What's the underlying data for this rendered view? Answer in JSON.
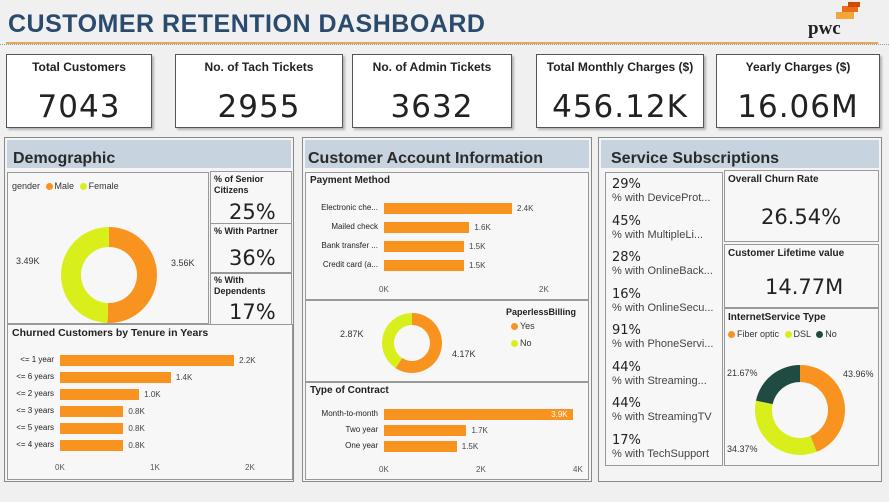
{
  "header": {
    "title": "CUSTOMER RETENTION DASHBOARD",
    "logo_text": "pwc"
  },
  "kpis": [
    {
      "label": "Total Customers",
      "value": "7043"
    },
    {
      "label": "No. of Tach Tickets",
      "value": "2955"
    },
    {
      "label": "No. of Admin Tickets",
      "value": "3632"
    },
    {
      "label": "Total Monthly Charges ($)",
      "value": "456.12K"
    },
    {
      "label": "Yearly Charges ($)",
      "value": "16.06M"
    }
  ],
  "demographic": {
    "title": "Demographic",
    "gender_legend": {
      "title": "gender",
      "items": [
        "Male",
        "Female"
      ]
    },
    "gender_left_label": "3.49K",
    "gender_right_label": "3.56K",
    "senior_label": "% of Senior Citizens",
    "senior_value": "25%",
    "partner_label": "% With Partner",
    "partner_value": "36%",
    "dependents_label": "% With Dependents",
    "dependents_value": "17%",
    "tenure_title": "Churned Customers by Tenure in Years",
    "tenure_ticks": [
      "0K",
      "1K",
      "2K"
    ]
  },
  "account": {
    "title": "Customer Account Information",
    "payment_title": "Payment Method",
    "payment_ticks": [
      "0K",
      "2K"
    ],
    "paperless_title": "PaperlessBilling",
    "paperless_items": [
      "Yes",
      "No"
    ],
    "paperless_left_label": "2.87K",
    "paperless_right_label": "4.17K",
    "contract_title": "Type of Contract",
    "contract_ticks": [
      "0K",
      "2K",
      "4K"
    ]
  },
  "services": {
    "title": "Service Subscriptions",
    "items": [
      {
        "pct": "29%",
        "label": "% with DeviceProt..."
      },
      {
        "pct": "45%",
        "label": "% with MultipleLi..."
      },
      {
        "pct": "28%",
        "label": "% with OnlineBack..."
      },
      {
        "pct": "16%",
        "label": "% with OnlineSecu..."
      },
      {
        "pct": "91%",
        "label": "% with PhoneServi..."
      },
      {
        "pct": "44%",
        "label": "% with Streaming..."
      },
      {
        "pct": "44%",
        "label": "% with StreamingTV"
      },
      {
        "pct": "17%",
        "label": "% with TechSupport"
      }
    ],
    "churn_label": "Overall Churn Rate",
    "churn_value": "26.54%",
    "ltv_label": "Customer Lifetime value",
    "ltv_value": "14.77M",
    "internet_title": "InternetService Type",
    "internet_items": [
      "Fiber optic",
      "DSL",
      "No"
    ],
    "internet_labels": {
      "fiber": "43.96%",
      "dsl": "34.37%",
      "no": "21.67%"
    }
  },
  "colors": {
    "orange": "#f7931e",
    "lime": "#d8ef1b",
    "darkgreen": "#1f4b43",
    "title_blue": "#2a4a6e",
    "header_band": "#c7d3de"
  },
  "chart_data": [
    {
      "type": "pie",
      "title": "gender",
      "categories": [
        "Male",
        "Female"
      ],
      "values": [
        3.56,
        3.49
      ],
      "unit": "K"
    },
    {
      "type": "bar",
      "title": "Churned Customers by Tenure in Years",
      "categories": [
        "<= 1 year",
        "<= 6 years",
        "<= 2 years",
        "<= 3 years",
        "<= 5 years",
        "<= 4 years"
      ],
      "values": [
        2.2,
        1.4,
        1.0,
        0.8,
        0.8,
        0.8
      ],
      "value_labels": [
        "2.2K",
        "1.4K",
        "1.0K",
        "0.8K",
        "0.8K",
        "0.8K"
      ],
      "xlim": [
        0,
        2.4
      ],
      "orientation": "horizontal"
    },
    {
      "type": "bar",
      "title": "Payment Method",
      "categories": [
        "Electronic che...",
        "Mailed check",
        "Bank transfer ...",
        "Credit card (a..."
      ],
      "values": [
        2.4,
        1.6,
        1.5,
        1.5
      ],
      "value_labels": [
        "2.4K",
        "1.6K",
        "1.5K",
        "1.5K"
      ],
      "xlim": [
        0,
        3
      ],
      "orientation": "horizontal"
    },
    {
      "type": "pie",
      "title": "PaperlessBilling",
      "categories": [
        "Yes",
        "No"
      ],
      "values": [
        4.17,
        2.87
      ],
      "unit": "K"
    },
    {
      "type": "bar",
      "title": "Type of Contract",
      "categories": [
        "Month-to-month",
        "Two year",
        "One year"
      ],
      "values": [
        3.9,
        1.7,
        1.5
      ],
      "value_labels": [
        "3.9K",
        "1.7K",
        "1.5K"
      ],
      "xlim": [
        0,
        4
      ],
      "orientation": "horizontal"
    },
    {
      "type": "pie",
      "title": "InternetService Type",
      "categories": [
        "Fiber optic",
        "DSL",
        "No"
      ],
      "values": [
        43.96,
        34.37,
        21.67
      ],
      "unit": "%"
    }
  ]
}
